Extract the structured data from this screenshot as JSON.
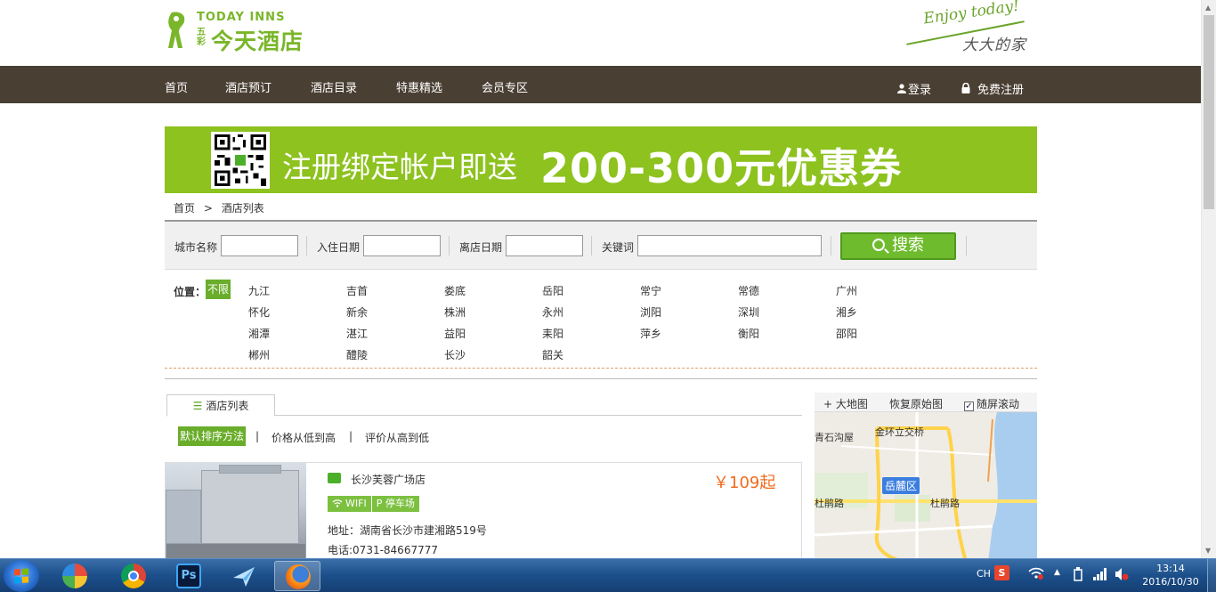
{
  "header": {
    "logo_en": "TODAY INNS",
    "logo_small": "五彩",
    "logo_cn": "今天酒店",
    "slogan_en": "Enjoy today!",
    "slogan_cn": "大大的家"
  },
  "nav": {
    "items": [
      "首页",
      "酒店预订",
      "酒店目录",
      "特惠精选",
      "会员专区"
    ],
    "login": "登录",
    "register": "免费注册"
  },
  "banner": {
    "text": "注册绑定帐户即送",
    "big": "200-300元优惠券"
  },
  "breadcrumb": {
    "home": "首页",
    "sep": ">",
    "current": "酒店列表"
  },
  "search": {
    "city_label": "城市名称",
    "checkin_label": "入住日期",
    "checkout_label": "离店日期",
    "keyword_label": "关键词",
    "button_label": "搜索"
  },
  "location": {
    "label": "位置：",
    "any": "不限",
    "cities": [
      "九江",
      "吉首",
      "娄底",
      "岳阳",
      "常宁",
      "常德",
      "广州",
      "怀化",
      "新余",
      "株洲",
      "永州",
      "浏阳",
      "深圳",
      "湘乡",
      "湘潭",
      "湛江",
      "益阳",
      "耒阳",
      "萍乡",
      "衡阳",
      "邵阳",
      "郴州",
      "醴陵",
      "长沙",
      "韶关"
    ]
  },
  "list": {
    "tab_label": "酒店列表",
    "sort_default": "默认排序方法",
    "sort_price": "价格从低到高",
    "sort_rating": "评价从高到低",
    "sep": "|"
  },
  "hotel": {
    "name": "长沙芙蓉广场店",
    "price": "￥109起",
    "badge_wifi": "WIFI",
    "badge_parking": "P 停车场",
    "address": "地址：湖南省长沙市建湘路519号",
    "phone": "电话:0731-84667777"
  },
  "map": {
    "big_map": "+ 大地图",
    "restore": "恢复原始图",
    "follow_scroll": "随屏滚动",
    "labels": [
      "金环立交桥",
      "青石沟屋",
      "岳麓区",
      "杜鹃路",
      "杜鹃路"
    ],
    "district": "岳麓区"
  },
  "taskbar": {
    "lang": "CH",
    "time": "13:14",
    "date": "2016/10/30"
  },
  "colors": {
    "brand_green": "#8dc21f",
    "nav_brown": "#4a3f33",
    "price_orange": "#f26b1d"
  }
}
